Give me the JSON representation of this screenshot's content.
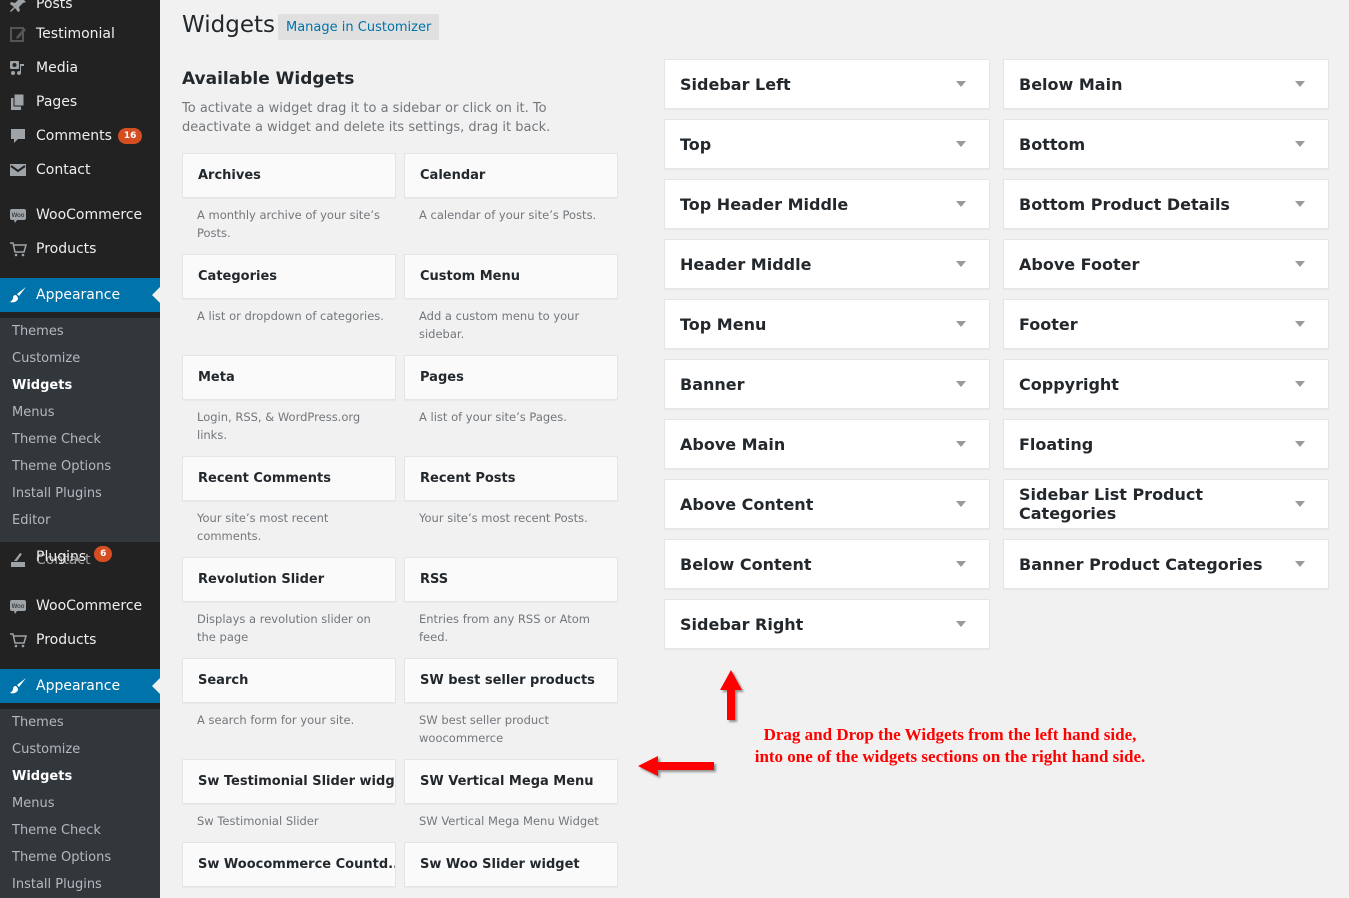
{
  "sidebar": {
    "items": [
      {
        "label": "Posts",
        "icon": "pin-icon"
      },
      {
        "label": "Testimonial",
        "icon": "edit-icon"
      },
      {
        "label": "Media",
        "icon": "media-icon"
      },
      {
        "label": "Pages",
        "icon": "pages-icon"
      },
      {
        "label": "Comments",
        "icon": "comment-icon",
        "badge": "16"
      },
      {
        "label": "Contact",
        "icon": "envelope-icon"
      },
      {
        "label": "WooCommerce",
        "icon": "woo-icon"
      },
      {
        "label": "Products",
        "icon": "cart-icon"
      },
      {
        "label": "Appearance",
        "icon": "paintbrush-icon"
      }
    ],
    "appearance_submenu": [
      "Themes",
      "Customize",
      "Widgets",
      "Menus",
      "Theme Check",
      "Theme Options",
      "Install Plugins",
      "Editor"
    ],
    "plugins": {
      "label": "Plugins",
      "overlap_label": "Contact",
      "badge": "6"
    },
    "repeat_items": [
      {
        "label": "WooCommerce",
        "icon": "woo-icon"
      },
      {
        "label": "Products",
        "icon": "cart-icon"
      },
      {
        "label": "Appearance",
        "icon": "paintbrush-icon"
      }
    ],
    "repeat_submenu": [
      "Themes",
      "Customize",
      "Widgets",
      "Menus",
      "Theme Check",
      "Theme Options",
      "Install Plugins"
    ],
    "current_submenu": "Widgets"
  },
  "header": {
    "title": "Widgets",
    "manage_button": "Manage in Customizer"
  },
  "available": {
    "title": "Available Widgets",
    "description": "To activate a widget drag it to a sidebar or click on it. To deactivate a widget and delete its settings, drag it back.",
    "widgets": [
      {
        "name": "Archives",
        "desc": "A monthly archive of your site’s Posts."
      },
      {
        "name": "Calendar",
        "desc": "A calendar of your site’s Posts."
      },
      {
        "name": "Categories",
        "desc": "A list or dropdown of categories."
      },
      {
        "name": "Custom Menu",
        "desc": "Add a custom menu to your sidebar."
      },
      {
        "name": "Meta",
        "desc": "Login, RSS, & WordPress.org links."
      },
      {
        "name": "Pages",
        "desc": "A list of your site’s Pages."
      },
      {
        "name": "Recent Comments",
        "desc": "Your site’s most recent comments."
      },
      {
        "name": "Recent Posts",
        "desc": "Your site’s most recent Posts."
      },
      {
        "name": "Revolution Slider",
        "desc": "Displays a revolution slider on the page"
      },
      {
        "name": "RSS",
        "desc": "Entries from any RSS or Atom feed."
      },
      {
        "name": "Search",
        "desc": "A search form for your site."
      },
      {
        "name": "SW best seller products",
        "desc": "SW best seller product woocommerce"
      },
      {
        "name": "Sw Testimonial Slider widget",
        "desc": "Sw Testimonial Slider"
      },
      {
        "name": "SW Vertical Mega Menu",
        "desc": "SW Vertical Mega Menu Widget"
      },
      {
        "name": "Sw Woocommerce Countd...",
        "desc": ""
      },
      {
        "name": "Sw Woo Slider widget",
        "desc": ""
      }
    ]
  },
  "widget_areas": {
    "left": [
      "Sidebar Left",
      "Top",
      "Top Header Middle",
      "Header Middle",
      "Top Menu",
      "Banner",
      "Above Main",
      "Above Content",
      "Below Content",
      "Sidebar Right"
    ],
    "right": [
      "Below Main",
      "Bottom",
      "Bottom Product Details",
      "Above Footer",
      "Footer",
      "Coppyright",
      "Floating",
      "Sidebar List Product Categories",
      "Banner Product Categories"
    ]
  },
  "annotation": {
    "line1": "Drag and Drop the Widgets from the left hand side,",
    "line2": "into one of the widgets sections on the right hand side.",
    "color": "#ff0000"
  },
  "colors": {
    "menu_bg": "#222222",
    "submenu_bg": "#32373c",
    "accent": "#0073aa",
    "badge": "#d54e21",
    "page_bg": "#f1f1f1"
  }
}
